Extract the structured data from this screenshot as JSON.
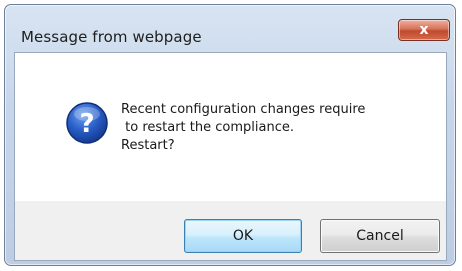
{
  "window": {
    "title": "Message from webpage",
    "close_glyph": "x"
  },
  "message": {
    "icon": "question-icon",
    "lines": [
      "Recent configuration changes require",
      " to restart the compliance.",
      "Restart?"
    ]
  },
  "buttons": {
    "ok_label": "OK",
    "cancel_label": "Cancel"
  },
  "colors": {
    "accent": "#3c7fb1",
    "close_button": "#c04a2e",
    "icon_blue": "#1f4fb5"
  }
}
